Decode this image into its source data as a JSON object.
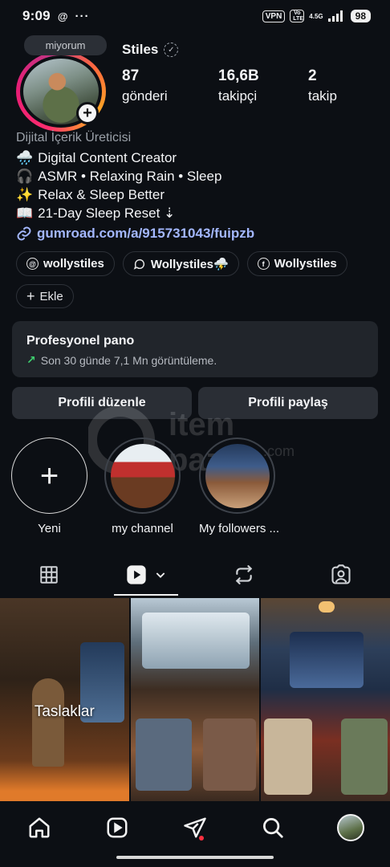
{
  "status_bar": {
    "time": "9:09",
    "vpn": "VPN",
    "volte": "Vo LTE",
    "network": "4.5G",
    "battery": "98"
  },
  "profile": {
    "note": "miyorum",
    "username": "Stiles",
    "stats": [
      {
        "value": "87",
        "label": "gönderi"
      },
      {
        "value": "16,6B",
        "label": "takipçi"
      },
      {
        "value": "2",
        "label": "takip"
      }
    ],
    "category": "Dijital İçerik Üreticisi",
    "bio_lines": [
      {
        "emoji": "🌧️",
        "text": "Digital Content Creator"
      },
      {
        "emoji": "🎧",
        "text": "ASMR • Relaxing Rain • Sleep"
      },
      {
        "emoji": "✨",
        "text": "Relax & Sleep Better"
      },
      {
        "emoji": "📖",
        "text": "21-Day Sleep Reset ⇣"
      }
    ],
    "link": "gumroad.com/a/915731043/fuipzb"
  },
  "links": {
    "threads": "wollystiles",
    "chat": "Wollystiles⛈️",
    "facebook": "Wollystiles",
    "add": "Ekle"
  },
  "dashboard": {
    "title": "Profesyonel pano",
    "subtitle": "Son 30 günde 7,1 Mn görüntüleme."
  },
  "buttons": {
    "edit": "Profili düzenle",
    "share": "Profili paylaş"
  },
  "highlights": [
    {
      "label": "Yeni"
    },
    {
      "label": "my channel"
    },
    {
      "label": "My followers ..."
    }
  ],
  "watermark": {
    "brand": "item",
    "domain": "pazar",
    "tld": ".com"
  },
  "tabs": [
    "grid",
    "reels",
    "reposts",
    "tagged"
  ],
  "grid": {
    "draft_label": "Taslaklar"
  },
  "nav": [
    "home",
    "reels",
    "send",
    "search",
    "profile"
  ],
  "colors": {
    "background": "#0c0f14",
    "link": "#a3b7ff",
    "card": "#21252b",
    "growth": "#3ecf6e"
  }
}
